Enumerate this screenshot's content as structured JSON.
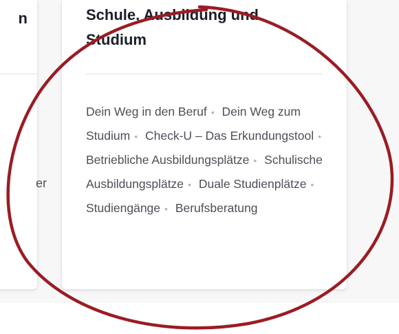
{
  "left_card": {
    "title_fragment": "n",
    "text_fragment": "er"
  },
  "main_card": {
    "title": "Schule, Ausbildung und\nStudium",
    "separator": "•",
    "links": [
      "Dein Weg in den Beruf",
      "Dein Weg zum Studium",
      "Check-U – Das Erkundungstool",
      "Betriebliche Ausbildungsplätze",
      "Schulische Ausbildungsplätze",
      "Duale Studienplätze",
      "Studiengänge",
      "Berufsberatung"
    ]
  },
  "annotation": {
    "shape": "hand-drawn ellipse",
    "color": "#9b1c24"
  }
}
